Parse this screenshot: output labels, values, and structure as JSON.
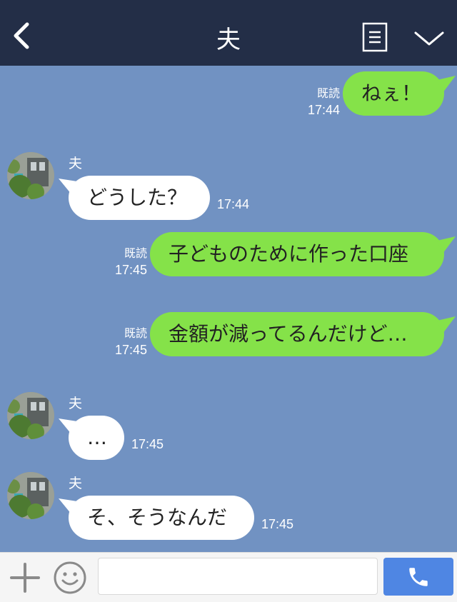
{
  "header": {
    "title": "夫",
    "icons": [
      "chevron-left-icon",
      "note-list-icon",
      "chevron-down-icon"
    ]
  },
  "messages": [
    {
      "direction": "out",
      "text": "ねぇ！",
      "read": "既読",
      "time": "17:44"
    },
    {
      "direction": "in",
      "sender": "夫",
      "text": "どうした？",
      "time": "17:44"
    },
    {
      "direction": "out",
      "text": "子どものために作った口座",
      "read": "既読",
      "time": "17:45"
    },
    {
      "direction": "out",
      "text": "金額が減ってるんだけど…",
      "read": "既読",
      "time": "17:45"
    },
    {
      "direction": "in",
      "sender": "夫",
      "text": "…",
      "time": "17:45"
    },
    {
      "direction": "in",
      "sender": "夫",
      "text": "そ、そうなんだ",
      "time": "17:45"
    }
  ],
  "footer": {
    "input_placeholder": "",
    "input_value": "",
    "icons": [
      "plus-icon",
      "smiley-icon",
      "phone-icon"
    ]
  },
  "colors": {
    "header_bg": "#232e47",
    "chat_bg": "#7192c2",
    "outgoing_bubble": "#85e249",
    "incoming_bubble": "#ffffff",
    "call_button": "#4f86e3"
  }
}
